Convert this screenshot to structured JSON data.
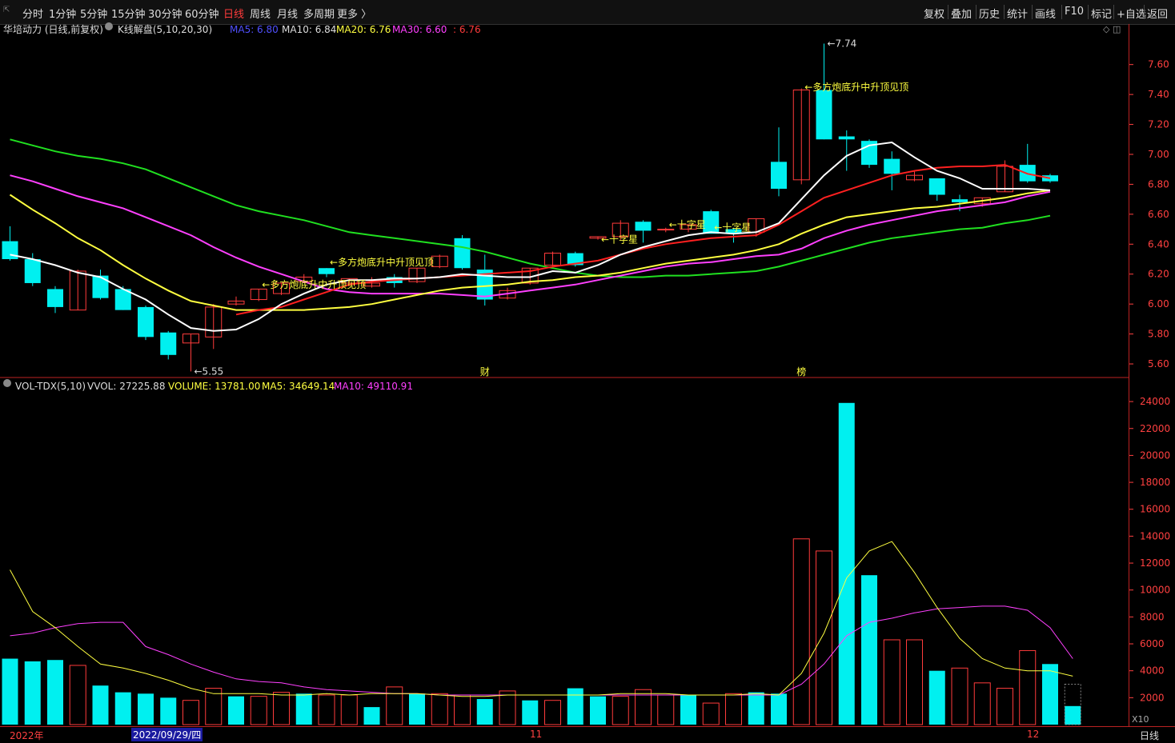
{
  "toolbar": {
    "periods": [
      "分时",
      "1分钟",
      "5分钟",
      "15分钟",
      "30分钟",
      "60分钟",
      "日线",
      "周线",
      "月线",
      "多周期",
      "更多 〉"
    ],
    "active_period": "日线",
    "tools": [
      "复权",
      "叠加",
      "历史",
      "统计",
      "画线",
      "F10",
      "标记",
      "+自选",
      "返回"
    ]
  },
  "price_header": {
    "stock": "华培动力 (日线,前复权)",
    "indicator": "K线解盘(5,10,20,30)",
    "ma5": "MA5: 6.80",
    "ma10": "MA10: 6.84",
    "ma20": "MA20: 6.76",
    "ma30": "MA30: 6.60",
    "last": ": 6.76"
  },
  "volume_header": {
    "indicator": "VOL-TDX(5,10)",
    "vvol": "VVOL: 27225.88",
    "volume": "VOLUME: 13781.00",
    "ma5": "MA5: 34649.14",
    "ma10": "MA10: 49110.91"
  },
  "x_axis": {
    "labels": [
      "2022年",
      "2022/09/29/四",
      "11",
      "12"
    ],
    "period_label": "日线"
  },
  "colors": {
    "up": "#ff3b3b",
    "down": "#00f0f0",
    "ma5": "#ffffff",
    "ma10": "#ff2020",
    "ma20": "#ffff40",
    "ma30": "#ff40ff",
    "ma60": "#20e020",
    "vol_ma5": "#ffff40",
    "vol_ma10": "#ff40ff",
    "grid": "#7a0000",
    "axis_text": "#ff4040"
  },
  "chart_data": [
    {
      "type": "candlestick",
      "y_ticks": [
        5.6,
        5.8,
        6.0,
        6.2,
        6.4,
        6.6,
        6.8,
        7.0,
        7.2,
        7.4,
        7.6
      ],
      "ylim": [
        5.52,
        7.78
      ],
      "ohlc": [
        [
          6.42,
          6.52,
          6.29,
          6.3
        ],
        [
          6.3,
          6.34,
          6.12,
          6.14
        ],
        [
          6.1,
          6.12,
          5.94,
          5.98
        ],
        [
          5.96,
          6.23,
          5.96,
          6.22
        ],
        [
          6.19,
          6.23,
          6.03,
          6.04
        ],
        [
          6.1,
          6.12,
          5.96,
          5.96
        ],
        [
          5.98,
          5.99,
          5.76,
          5.78
        ],
        [
          5.81,
          5.82,
          5.63,
          5.66
        ],
        [
          5.74,
          5.8,
          5.55,
          5.8
        ],
        [
          5.78,
          6.0,
          5.7,
          5.98
        ],
        [
          6.0,
          6.05,
          5.99,
          6.02
        ],
        [
          6.03,
          6.1,
          6.02,
          6.1
        ],
        [
          6.07,
          6.14,
          6.06,
          6.14
        ],
        [
          6.15,
          6.2,
          6.14,
          6.18
        ],
        [
          6.24,
          6.24,
          6.18,
          6.2
        ],
        [
          6.14,
          6.17,
          6.12,
          6.17
        ],
        [
          6.12,
          6.18,
          6.11,
          6.14
        ],
        [
          6.18,
          6.2,
          6.11,
          6.14
        ],
        [
          6.15,
          6.24,
          6.14,
          6.24
        ],
        [
          6.25,
          6.33,
          6.24,
          6.32
        ],
        [
          6.44,
          6.46,
          6.23,
          6.24
        ],
        [
          6.23,
          6.33,
          5.99,
          6.03
        ],
        [
          6.04,
          6.11,
          6.03,
          6.09
        ],
        [
          6.14,
          6.24,
          6.13,
          6.24
        ],
        [
          6.26,
          6.35,
          6.25,
          6.34
        ],
        [
          6.34,
          6.35,
          6.25,
          6.26
        ],
        [
          6.44,
          6.45,
          6.43,
          6.45
        ],
        [
          6.45,
          6.56,
          6.43,
          6.54
        ],
        [
          6.55,
          6.56,
          6.41,
          6.49
        ],
        [
          6.5,
          6.51,
          6.48,
          6.5
        ],
        [
          6.5,
          6.53,
          6.48,
          6.53
        ],
        [
          6.62,
          6.63,
          6.47,
          6.47
        ],
        [
          6.5,
          6.51,
          6.41,
          6.47
        ],
        [
          6.48,
          6.57,
          6.45,
          6.57
        ],
        [
          6.95,
          7.18,
          6.72,
          6.77
        ],
        [
          6.83,
          7.44,
          6.8,
          7.43
        ],
        [
          7.43,
          7.74,
          7.1,
          7.1
        ],
        [
          7.12,
          7.16,
          6.89,
          7.1
        ],
        [
          7.09,
          7.1,
          6.91,
          6.93
        ],
        [
          6.97,
          7.02,
          6.76,
          6.87
        ],
        [
          6.83,
          6.89,
          6.82,
          6.86
        ],
        [
          6.84,
          6.84,
          6.69,
          6.73
        ],
        [
          6.7,
          6.73,
          6.62,
          6.68
        ],
        [
          6.67,
          6.71,
          6.65,
          6.71
        ],
        [
          6.75,
          6.96,
          6.75,
          6.92
        ],
        [
          6.93,
          7.07,
          6.81,
          6.82
        ],
        [
          6.86,
          6.87,
          6.81,
          6.82
        ]
      ],
      "ma5": [
        6.33,
        6.3,
        6.26,
        6.21,
        6.18,
        6.1,
        6.03,
        5.93,
        5.84,
        5.82,
        5.83,
        5.9,
        6.0,
        6.07,
        6.13,
        6.16,
        6.16,
        6.17,
        6.17,
        6.18,
        6.2,
        6.19,
        6.18,
        6.18,
        6.22,
        6.21,
        6.26,
        6.33,
        6.38,
        6.42,
        6.46,
        6.48,
        6.47,
        6.48,
        6.54,
        6.7,
        6.86,
        6.99,
        7.06,
        7.08,
        6.98,
        6.89,
        6.84,
        6.77,
        6.77,
        6.77,
        6.76
      ],
      "ma10": [
        null,
        null,
        null,
        null,
        null,
        null,
        null,
        null,
        null,
        null,
        5.93,
        5.96,
        5.98,
        6.03,
        6.08,
        6.13,
        6.15,
        6.16,
        6.17,
        6.18,
        6.19,
        6.2,
        6.21,
        6.22,
        6.25,
        6.27,
        6.29,
        6.33,
        6.37,
        6.4,
        6.42,
        6.44,
        6.45,
        6.46,
        6.53,
        6.62,
        6.71,
        6.76,
        6.81,
        6.86,
        6.89,
        6.91,
        6.92,
        6.92,
        6.93,
        6.87,
        6.84
      ],
      "ma20": [
        6.73,
        6.63,
        6.54,
        6.44,
        6.36,
        6.26,
        6.17,
        6.09,
        6.02,
        5.99,
        5.96,
        5.96,
        5.96,
        5.96,
        5.97,
        5.98,
        6.0,
        6.03,
        6.06,
        6.09,
        6.11,
        6.12,
        6.13,
        6.15,
        6.16,
        6.18,
        6.19,
        6.21,
        6.24,
        6.27,
        6.29,
        6.31,
        6.33,
        6.36,
        6.4,
        6.47,
        6.53,
        6.58,
        6.6,
        6.62,
        6.64,
        6.65,
        6.67,
        6.69,
        6.71,
        6.74,
        6.76
      ],
      "ma30": [
        6.86,
        6.82,
        6.77,
        6.72,
        6.68,
        6.64,
        6.58,
        6.52,
        6.46,
        6.38,
        6.31,
        6.25,
        6.2,
        6.15,
        6.1,
        6.08,
        6.07,
        6.07,
        6.07,
        6.07,
        6.06,
        6.05,
        6.07,
        6.09,
        6.11,
        6.13,
        6.16,
        6.19,
        6.22,
        6.25,
        6.27,
        6.28,
        6.3,
        6.32,
        6.33,
        6.37,
        6.44,
        6.49,
        6.53,
        6.56,
        6.59,
        6.62,
        6.64,
        6.66,
        6.68,
        6.72,
        6.75
      ],
      "ma60": [
        7.1,
        7.06,
        7.02,
        6.99,
        6.97,
        6.94,
        6.9,
        6.84,
        6.78,
        6.72,
        6.66,
        6.62,
        6.59,
        6.56,
        6.52,
        6.48,
        6.46,
        6.44,
        6.42,
        6.4,
        6.38,
        6.35,
        6.31,
        6.27,
        6.24,
        6.21,
        6.19,
        6.18,
        6.18,
        6.19,
        6.19,
        6.2,
        6.21,
        6.22,
        6.25,
        6.29,
        6.33,
        6.37,
        6.41,
        6.44,
        6.46,
        6.48,
        6.5,
        6.51,
        6.54,
        6.56,
        6.59
      ],
      "annotations": [
        {
          "text": "←5.55",
          "bar": 8,
          "price": 5.55
        },
        {
          "text": "←7.74",
          "bar": 36,
          "price": 7.74
        },
        {
          "text": "←多方炮底升中升顶见顶",
          "bar": 11,
          "price": 6.13
        },
        {
          "text": "←多方炮底升中升顶见顶",
          "bar": 14,
          "price": 6.28
        },
        {
          "text": "←十字星",
          "bar": 26,
          "price": 6.43
        },
        {
          "text": "←十字星",
          "bar": 29,
          "price": 6.53
        },
        {
          "text": "←十字星",
          "bar": 31,
          "price": 6.51
        },
        {
          "text": "←多方炮底升中升顶见顶",
          "bar": 35,
          "price": 7.45
        }
      ],
      "markers": [
        {
          "text": "财",
          "bar": 21
        },
        {
          "text": "榜",
          "bar": 35
        }
      ]
    },
    {
      "type": "bar",
      "y_ticks": [
        2000,
        4000,
        6000,
        8000,
        10000,
        12000,
        14000,
        16000,
        18000,
        20000,
        22000,
        24000
      ],
      "unit_label": "X10",
      "ylim": [
        0,
        24600
      ],
      "volume": [
        4900,
        4700,
        4800,
        4400,
        2900,
        2400,
        2300,
        2000,
        1800,
        2700,
        2100,
        2100,
        2400,
        2300,
        2200,
        2200,
        1300,
        2800,
        2300,
        2300,
        2200,
        1900,
        2500,
        1800,
        1800,
        2700,
        2100,
        2100,
        2600,
        2200,
        2200,
        1600,
        2300,
        2400,
        2300,
        13800,
        12900,
        23900,
        11100,
        6300,
        6300,
        4000,
        4200,
        3100,
        2700,
        5500,
        4500,
        1378
      ],
      "vol_ma5": [
        11500,
        8400,
        7200,
        5800,
        4500,
        4200,
        3800,
        3300,
        2700,
        2300,
        2300,
        2300,
        2200,
        2200,
        2300,
        2200,
        2300,
        2300,
        2300,
        2200,
        2100,
        2100,
        2200,
        2200,
        2200,
        2200,
        2200,
        2300,
        2300,
        2300,
        2200,
        2200,
        2200,
        2300,
        2200,
        3800,
        6800,
        10900,
        12900,
        13600,
        11300,
        8700,
        6400,
        4900,
        4200,
        4000,
        4000,
        3600
      ],
      "vol_ma10": [
        6600,
        6800,
        7200,
        7500,
        7600,
        7600,
        5800,
        5200,
        4500,
        3900,
        3400,
        3200,
        3100,
        2800,
        2600,
        2500,
        2400,
        2300,
        2300,
        2200,
        2200,
        2200,
        2200,
        2200,
        2200,
        2200,
        2200,
        2200,
        2200,
        2200,
        2200,
        2200,
        2200,
        2200,
        2200,
        3000,
        4500,
        6600,
        7600,
        7900,
        8300,
        8600,
        8700,
        8800,
        8800,
        8500,
        7200,
        4900
      ],
      "up_bars": [
        3,
        8,
        9,
        11,
        12,
        14,
        15,
        17,
        19,
        20,
        22,
        24,
        27,
        28,
        29,
        31,
        32,
        35,
        36,
        39,
        40,
        42,
        43,
        44,
        45,
        47
      ]
    }
  ]
}
